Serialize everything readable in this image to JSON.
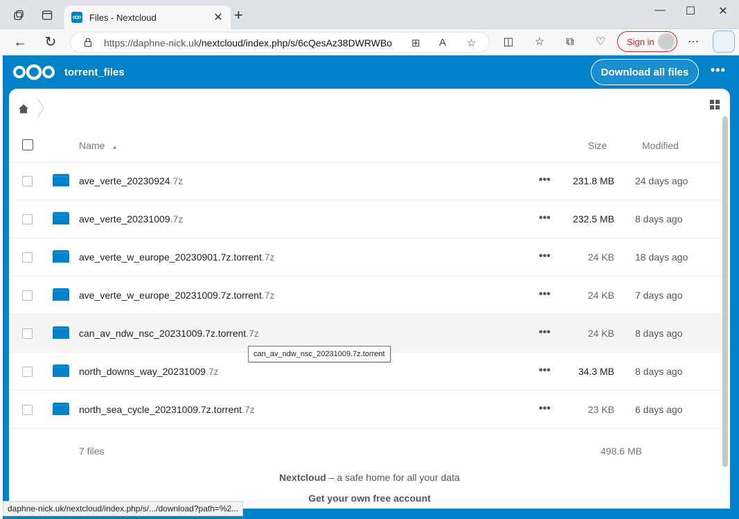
{
  "browser": {
    "tab_title": "Files - Nextcloud",
    "url_host": "https://daphne-nick.uk",
    "url_path": "/nextcloud/index.php/s/6cQesAz38DWRWBo",
    "signin_label": "Sign in",
    "status_url": "daphne-nick.uk/nextcloud/index.php/s/.../download?path=%2..."
  },
  "header": {
    "share_title": "torrent_files",
    "download_all_label": "Download all files",
    "more_label": "•••"
  },
  "columns": {
    "name": "Name",
    "size": "Size",
    "modified": "Modified"
  },
  "files": [
    {
      "base": "ave_verte_20230924",
      "ext": ".7z",
      "size": "231.8 MB",
      "modified": "24 days ago"
    },
    {
      "base": "ave_verte_20231009",
      "ext": ".7z",
      "size": "232.5 MB",
      "modified": "8 days ago"
    },
    {
      "base": "ave_verte_w_europe_20230901.7z.torrent",
      "ext": ".7z",
      "size": "24 KB",
      "modified": "18 days ago"
    },
    {
      "base": "ave_verte_w_europe_20231009.7z.torrent",
      "ext": ".7z",
      "size": "24 KB",
      "modified": "7 days ago"
    },
    {
      "base": "can_av_ndw_nsc_20231009.7z.torrent",
      "ext": ".7z",
      "size": "24 KB",
      "modified": "8 days ago"
    },
    {
      "base": "north_downs_way_20231009",
      "ext": ".7z",
      "size": "34.3 MB",
      "modified": "8 days ago"
    },
    {
      "base": "north_sea_cycle_20231009.7z.torrent",
      "ext": ".7z",
      "size": "23 KB",
      "modified": "6 days ago"
    }
  ],
  "row_actions_label": "•••",
  "summary": {
    "count": "7 files",
    "total": "498.6 MB"
  },
  "footer": {
    "brand": "Nextcloud",
    "tagline": " – a safe home for all your data",
    "cta": "Get your own free account"
  },
  "tooltip": "can_av_ndw_nsc_20231009.7z.torrent",
  "colors": {
    "brand": "#0082c9",
    "signin": "#c9252c"
  }
}
